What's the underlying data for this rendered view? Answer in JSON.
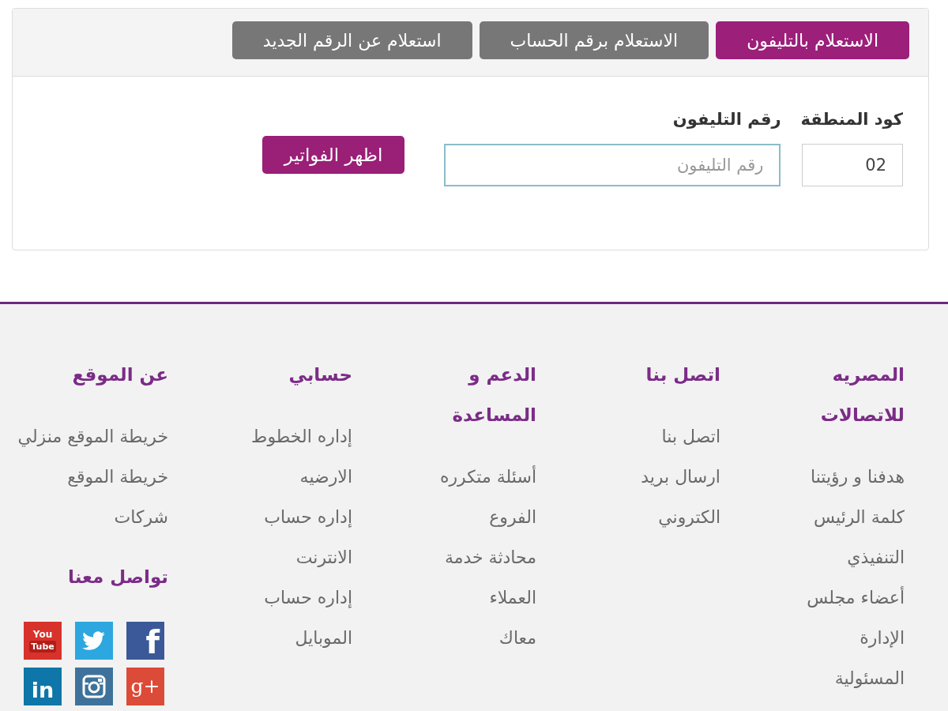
{
  "tabs": [
    {
      "label": "الاستعلام بالتليفون",
      "selected": true
    },
    {
      "label": "الاستعلام برقم الحساب",
      "selected": false
    },
    {
      "label": "استعلام عن الرقم الجديد",
      "selected": false
    }
  ],
  "form": {
    "fields": [
      {
        "label": "كود المنطقة",
        "value": "02",
        "focused": false
      },
      {
        "label": "رقم التليفون",
        "placeholder": "رقم التليفون",
        "focused": true
      }
    ],
    "submit_button": "اظهر الفواتير"
  },
  "footer": {
    "columns": [
      {
        "heading": "المصريه\nللاتصالات",
        "links": [
          "هدفنا و رؤيتنا",
          "كلمة الرئيس\nالتنفيذي",
          "أعضاء مجلس\nالإدارة",
          "المسئولية"
        ]
      },
      {
        "heading": "اتصل بنا",
        "links": [
          "اتصل بنا",
          "ارسال بريد\nالكتروني"
        ]
      },
      {
        "heading": "الدعم و\nالمساعدة",
        "links": [
          "أسئلة متكرره",
          "الفروع",
          "محادثة خدمة\nالعملاء",
          "معاك"
        ]
      },
      {
        "heading": "حسابي",
        "links": [
          "إداره الخطوط\nالارضيه",
          "إداره حساب\nالانترنت",
          "إداره حساب\nالموبايل"
        ]
      },
      {
        "heading": "عن الموقع",
        "links": [
          "خريطة الموقع منزلي",
          "خريطة الموقع\nشركات"
        ],
        "social": {
          "heading": "تواصل معنا",
          "icons": [
            {
              "kind": "facebook",
              "color": "#3b5998",
              "text": "f"
            },
            {
              "kind": "twitter",
              "color": "#2ca7e0"
            },
            {
              "kind": "youtube",
              "color": "#d7322b",
              "text": "You",
              "text_2": "Tube"
            },
            {
              "kind": "googleplus",
              "color": "#dc4a38",
              "text": "g+"
            },
            {
              "kind": "instagram",
              "color": "#3e729a"
            },
            {
              "kind": "linkedin",
              "color": "#0e76a8",
              "text": "in"
            }
          ]
        }
      }
    ]
  }
}
